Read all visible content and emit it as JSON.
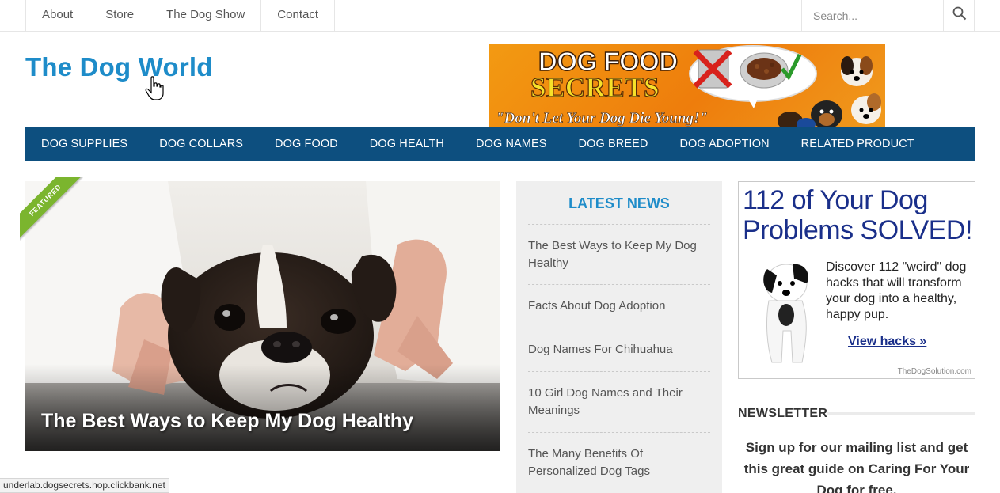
{
  "topnav": {
    "items": [
      {
        "label": "About"
      },
      {
        "label": "Store"
      },
      {
        "label": "The Dog Show"
      },
      {
        "label": "Contact"
      }
    ],
    "search_placeholder": "Search..."
  },
  "header": {
    "site_title": "The Dog World",
    "banner": {
      "line1": "DOG FOOD",
      "line2": "SECRETS",
      "line3": "\"Don't Let Your Dog Die Young!\""
    }
  },
  "mainnav": {
    "items": [
      {
        "label": "DOG SUPPLIES"
      },
      {
        "label": "DOG COLLARS"
      },
      {
        "label": "DOG FOOD"
      },
      {
        "label": "DOG HEALTH"
      },
      {
        "label": "DOG NAMES"
      },
      {
        "label": "DOG BREED"
      },
      {
        "label": "DOG ADOPTION"
      },
      {
        "label": "RELATED PRODUCT"
      }
    ]
  },
  "featured": {
    "badge": "FEATURED",
    "title": "The Best Ways to Keep My Dog Healthy"
  },
  "latest_news": {
    "heading": "LATEST NEWS",
    "items": [
      {
        "title": "The Best Ways to Keep My Dog Healthy"
      },
      {
        "title": "Facts About Dog Adoption"
      },
      {
        "title": "Dog Names For Chihuahua"
      },
      {
        "title": "10 Girl Dog Names and Their Meanings"
      },
      {
        "title": "The Many Benefits Of Personalized Dog Tags"
      }
    ]
  },
  "ad": {
    "headline": "112 of Your Dog Problems SOLVED!",
    "body": "Discover 112 \"weird\" dog hacks that will transform your dog into a healthy, happy pup.",
    "link": "View hacks »",
    "source": "TheDogSolution.com"
  },
  "newsletter": {
    "title": "NEWSLETTER",
    "text": "Sign up for our mailing list and get this great guide on Caring For Your Dog for free."
  },
  "status_bar": {
    "url": "underlab.dogsecrets.hop.clickbank.net"
  },
  "colors": {
    "brand_blue": "#1e8cc9",
    "nav_bg": "#0d4f7f",
    "ribbon_green": "#7bb52e"
  }
}
